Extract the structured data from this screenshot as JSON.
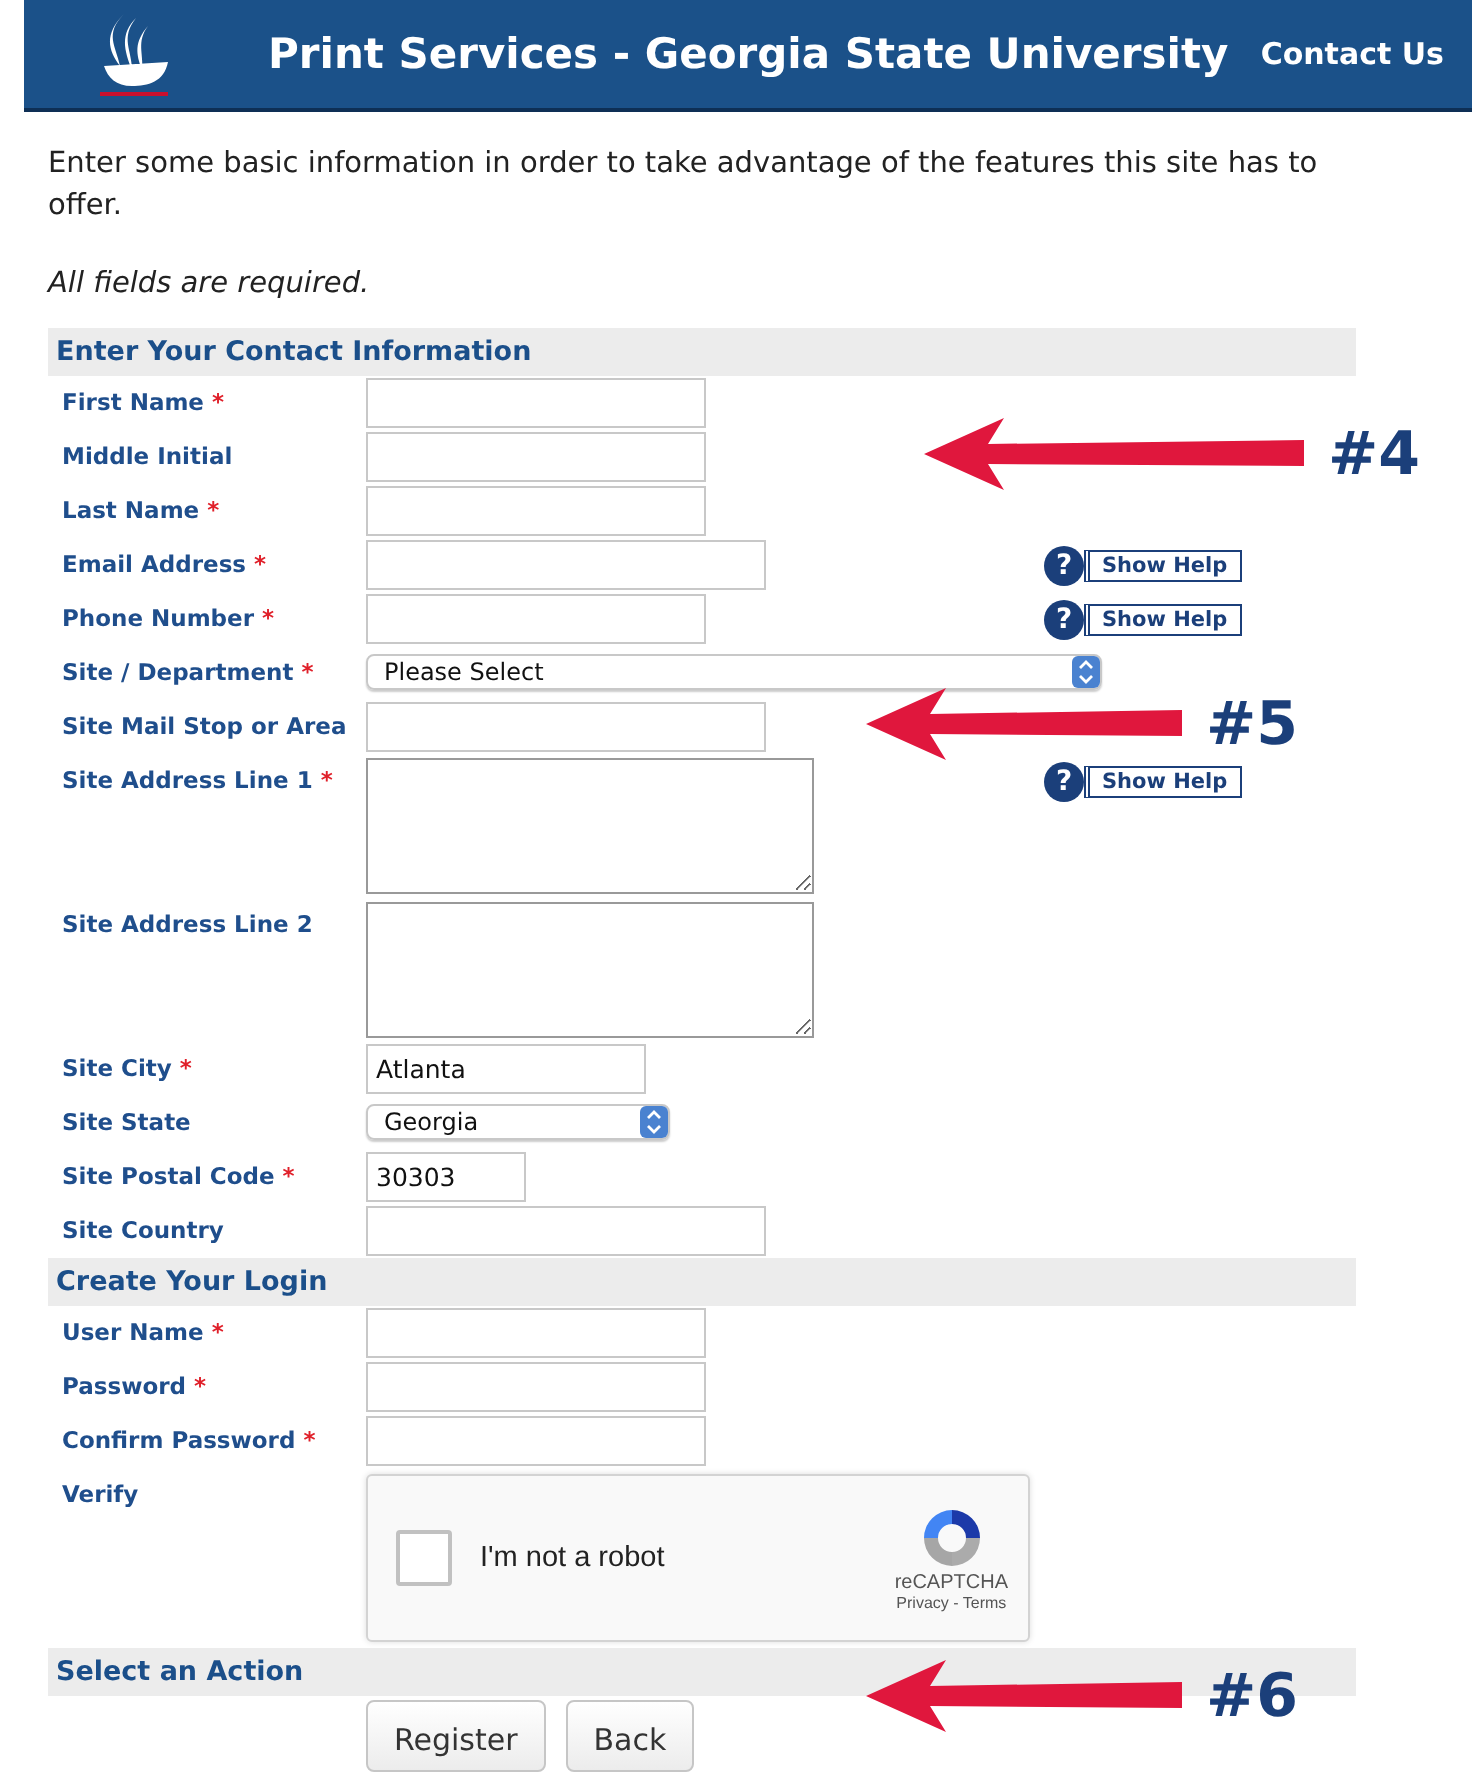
{
  "header": {
    "title": "Print Services - Georgia State University",
    "contact_link": "Contact Us"
  },
  "intro": "Enter some basic information in order to take advantage of the features this site has to offer.",
  "note": "All fields are required.",
  "sections": [
    {
      "title": "Enter Your Contact Information",
      "fields": [
        {
          "label": "First Name",
          "mark": "*",
          "kind": "input"
        },
        {
          "label": "Middle Initial",
          "kind": "input",
          "callout": "#4"
        },
        {
          "label": "Last Name",
          "mark": "*",
          "kind": "input"
        },
        {
          "label": "Email Address",
          "mark": "*",
          "kind": "wideinput",
          "help": {
            "icon": "?",
            "text": "Show Help"
          }
        },
        {
          "label": "Phone Number",
          "mark": "*",
          "kind": "input",
          "help": {
            "icon": "?",
            "text": "Show Help"
          }
        },
        {
          "label": "Site / Department",
          "mark": "*",
          "kind": "select",
          "value": "Please Select"
        },
        {
          "label": "Site Mail Stop or Area",
          "kind": "wideinput",
          "callout": "#5"
        },
        {
          "label": "Site Address Line 1",
          "mark": "*",
          "kind": "textarea",
          "help": {
            "icon": "?",
            "text": "Show Help"
          }
        },
        {
          "label": "Site Address Line 2",
          "kind": "textarea"
        },
        {
          "label": "Site City",
          "mark": "*",
          "kind": "cityinput",
          "value": "Atlanta"
        },
        {
          "label": "Site State",
          "kind": "stateselect",
          "value": "Georgia"
        },
        {
          "label": "Site Postal Code",
          "mark": "*",
          "kind": "zipinput",
          "value": "30303"
        },
        {
          "label": "Site Country",
          "kind": "wideinput"
        }
      ]
    },
    {
      "title": "Create Your Login",
      "fields": [
        {
          "label": "User Name",
          "mark": "*",
          "kind": "input"
        },
        {
          "label": "Password",
          "mark": "*",
          "kind": "input"
        },
        {
          "label": "Confirm Password",
          "mark": "*",
          "kind": "input"
        },
        {
          "label": "Verify",
          "kind": "captcha",
          "captcha": {
            "checked": false,
            "text": "I'm not a robot",
            "brand": "reCAPTCHA",
            "links": "Privacy - Terms"
          }
        }
      ]
    },
    {
      "title": "Select an Action",
      "callout": "#6",
      "buttons": [
        "Register",
        "Back"
      ]
    }
  ]
}
